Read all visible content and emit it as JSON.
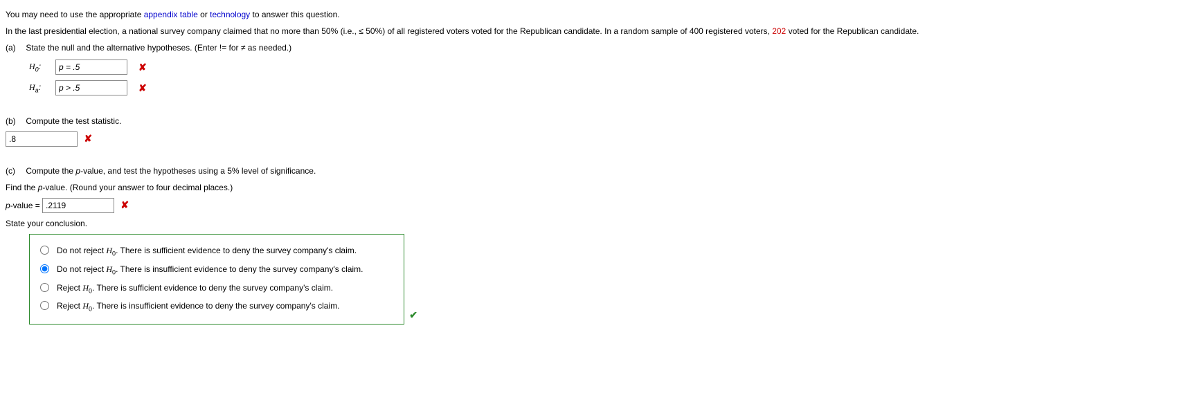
{
  "intro": {
    "pre": "You may need to use the appropriate ",
    "link1": "appendix table",
    "mid": " or ",
    "link2": "technology",
    "post": " to answer this question."
  },
  "context": {
    "pre": "In the last presidential election, a national survey company claimed that no more than 50% (i.e., ≤ 50%) of all registered voters voted for the Republican candidate. In a random sample of 400 registered voters, ",
    "highlight": "202",
    "post": " voted for the Republican candidate."
  },
  "parts": {
    "a": {
      "label": "(a)",
      "text": "State the null and the alternative hypotheses. (Enter != for ≠ as needed.)",
      "h0_label": "H",
      "h0_sub": "0",
      "h0_colon": ":",
      "h0_value": "p = .5",
      "ha_label": "H",
      "ha_sub": "a",
      "ha_colon": ":",
      "ha_value": "p > .5"
    },
    "b": {
      "label": "(b)",
      "text": "Compute the test statistic.",
      "value": ".8"
    },
    "c": {
      "label": "(c)",
      "text_main": "Compute the ",
      "text_p": "p",
      "text_rest": "-value, and test the hypotheses using a 5% level of significance.",
      "find_pre": "Find the ",
      "find_p": "p",
      "find_post": "-value. (Round your answer to four decimal places.)",
      "pv_label_pre": "p",
      "pv_label_post": "-value = ",
      "pv_value": ".2119",
      "conclusion_heading": "State your conclusion.",
      "options": [
        {
          "pre": "Do not reject ",
          "h": "H",
          "sub": "0",
          "post": ". There is sufficient evidence to deny the survey company's claim."
        },
        {
          "pre": "Do not reject ",
          "h": "H",
          "sub": "0",
          "post": ". There is insufficient evidence to deny the survey company's claim."
        },
        {
          "pre": "Reject ",
          "h": "H",
          "sub": "0",
          "post": ". There is sufficient evidence to deny the survey company's claim."
        },
        {
          "pre": "Reject ",
          "h": "H",
          "sub": "0",
          "post": ". There is insufficient evidence to deny the survey company's claim."
        }
      ],
      "selected": 1
    }
  },
  "marks": {
    "incorrect": "✘",
    "correct": "✔"
  }
}
